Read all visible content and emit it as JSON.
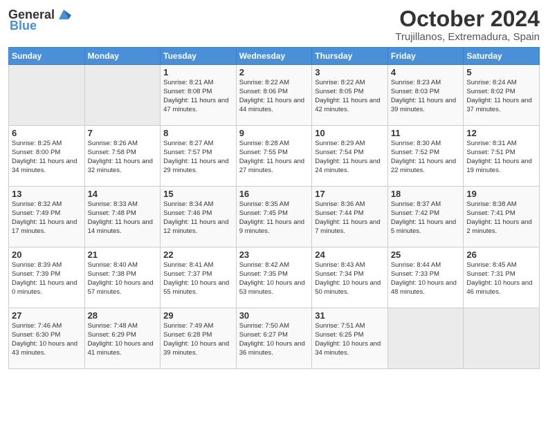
{
  "header": {
    "logo": {
      "text1": "General",
      "text2": "Blue"
    },
    "title": "October 2024",
    "location": "Trujillanos, Extremadura, Spain"
  },
  "days_of_week": [
    "Sunday",
    "Monday",
    "Tuesday",
    "Wednesday",
    "Thursday",
    "Friday",
    "Saturday"
  ],
  "weeks": [
    [
      {
        "day": "",
        "sunrise": "",
        "sunset": "",
        "daylight": ""
      },
      {
        "day": "",
        "sunrise": "",
        "sunset": "",
        "daylight": ""
      },
      {
        "day": "1",
        "sunrise": "Sunrise: 8:21 AM",
        "sunset": "Sunset: 8:08 PM",
        "daylight": "Daylight: 11 hours and 47 minutes."
      },
      {
        "day": "2",
        "sunrise": "Sunrise: 8:22 AM",
        "sunset": "Sunset: 8:06 PM",
        "daylight": "Daylight: 11 hours and 44 minutes."
      },
      {
        "day": "3",
        "sunrise": "Sunrise: 8:22 AM",
        "sunset": "Sunset: 8:05 PM",
        "daylight": "Daylight: 11 hours and 42 minutes."
      },
      {
        "day": "4",
        "sunrise": "Sunrise: 8:23 AM",
        "sunset": "Sunset: 8:03 PM",
        "daylight": "Daylight: 11 hours and 39 minutes."
      },
      {
        "day": "5",
        "sunrise": "Sunrise: 8:24 AM",
        "sunset": "Sunset: 8:02 PM",
        "daylight": "Daylight: 11 hours and 37 minutes."
      }
    ],
    [
      {
        "day": "6",
        "sunrise": "Sunrise: 8:25 AM",
        "sunset": "Sunset: 8:00 PM",
        "daylight": "Daylight: 11 hours and 34 minutes."
      },
      {
        "day": "7",
        "sunrise": "Sunrise: 8:26 AM",
        "sunset": "Sunset: 7:58 PM",
        "daylight": "Daylight: 11 hours and 32 minutes."
      },
      {
        "day": "8",
        "sunrise": "Sunrise: 8:27 AM",
        "sunset": "Sunset: 7:57 PM",
        "daylight": "Daylight: 11 hours and 29 minutes."
      },
      {
        "day": "9",
        "sunrise": "Sunrise: 8:28 AM",
        "sunset": "Sunset: 7:55 PM",
        "daylight": "Daylight: 11 hours and 27 minutes."
      },
      {
        "day": "10",
        "sunrise": "Sunrise: 8:29 AM",
        "sunset": "Sunset: 7:54 PM",
        "daylight": "Daylight: 11 hours and 24 minutes."
      },
      {
        "day": "11",
        "sunrise": "Sunrise: 8:30 AM",
        "sunset": "Sunset: 7:52 PM",
        "daylight": "Daylight: 11 hours and 22 minutes."
      },
      {
        "day": "12",
        "sunrise": "Sunrise: 8:31 AM",
        "sunset": "Sunset: 7:51 PM",
        "daylight": "Daylight: 11 hours and 19 minutes."
      }
    ],
    [
      {
        "day": "13",
        "sunrise": "Sunrise: 8:32 AM",
        "sunset": "Sunset: 7:49 PM",
        "daylight": "Daylight: 11 hours and 17 minutes."
      },
      {
        "day": "14",
        "sunrise": "Sunrise: 8:33 AM",
        "sunset": "Sunset: 7:48 PM",
        "daylight": "Daylight: 11 hours and 14 minutes."
      },
      {
        "day": "15",
        "sunrise": "Sunrise: 8:34 AM",
        "sunset": "Sunset: 7:46 PM",
        "daylight": "Daylight: 11 hours and 12 minutes."
      },
      {
        "day": "16",
        "sunrise": "Sunrise: 8:35 AM",
        "sunset": "Sunset: 7:45 PM",
        "daylight": "Daylight: 11 hours and 9 minutes."
      },
      {
        "day": "17",
        "sunrise": "Sunrise: 8:36 AM",
        "sunset": "Sunset: 7:44 PM",
        "daylight": "Daylight: 11 hours and 7 minutes."
      },
      {
        "day": "18",
        "sunrise": "Sunrise: 8:37 AM",
        "sunset": "Sunset: 7:42 PM",
        "daylight": "Daylight: 11 hours and 5 minutes."
      },
      {
        "day": "19",
        "sunrise": "Sunrise: 8:38 AM",
        "sunset": "Sunset: 7:41 PM",
        "daylight": "Daylight: 11 hours and 2 minutes."
      }
    ],
    [
      {
        "day": "20",
        "sunrise": "Sunrise: 8:39 AM",
        "sunset": "Sunset: 7:39 PM",
        "daylight": "Daylight: 11 hours and 0 minutes."
      },
      {
        "day": "21",
        "sunrise": "Sunrise: 8:40 AM",
        "sunset": "Sunset: 7:38 PM",
        "daylight": "Daylight: 10 hours and 57 minutes."
      },
      {
        "day": "22",
        "sunrise": "Sunrise: 8:41 AM",
        "sunset": "Sunset: 7:37 PM",
        "daylight": "Daylight: 10 hours and 55 minutes."
      },
      {
        "day": "23",
        "sunrise": "Sunrise: 8:42 AM",
        "sunset": "Sunset: 7:35 PM",
        "daylight": "Daylight: 10 hours and 53 minutes."
      },
      {
        "day": "24",
        "sunrise": "Sunrise: 8:43 AM",
        "sunset": "Sunset: 7:34 PM",
        "daylight": "Daylight: 10 hours and 50 minutes."
      },
      {
        "day": "25",
        "sunrise": "Sunrise: 8:44 AM",
        "sunset": "Sunset: 7:33 PM",
        "daylight": "Daylight: 10 hours and 48 minutes."
      },
      {
        "day": "26",
        "sunrise": "Sunrise: 8:45 AM",
        "sunset": "Sunset: 7:31 PM",
        "daylight": "Daylight: 10 hours and 46 minutes."
      }
    ],
    [
      {
        "day": "27",
        "sunrise": "Sunrise: 7:46 AM",
        "sunset": "Sunset: 6:30 PM",
        "daylight": "Daylight: 10 hours and 43 minutes."
      },
      {
        "day": "28",
        "sunrise": "Sunrise: 7:48 AM",
        "sunset": "Sunset: 6:29 PM",
        "daylight": "Daylight: 10 hours and 41 minutes."
      },
      {
        "day": "29",
        "sunrise": "Sunrise: 7:49 AM",
        "sunset": "Sunset: 6:28 PM",
        "daylight": "Daylight: 10 hours and 39 minutes."
      },
      {
        "day": "30",
        "sunrise": "Sunrise: 7:50 AM",
        "sunset": "Sunset: 6:27 PM",
        "daylight": "Daylight: 10 hours and 36 minutes."
      },
      {
        "day": "31",
        "sunrise": "Sunrise: 7:51 AM",
        "sunset": "Sunset: 6:25 PM",
        "daylight": "Daylight: 10 hours and 34 minutes."
      },
      {
        "day": "",
        "sunrise": "",
        "sunset": "",
        "daylight": ""
      },
      {
        "day": "",
        "sunrise": "",
        "sunset": "",
        "daylight": ""
      }
    ]
  ]
}
